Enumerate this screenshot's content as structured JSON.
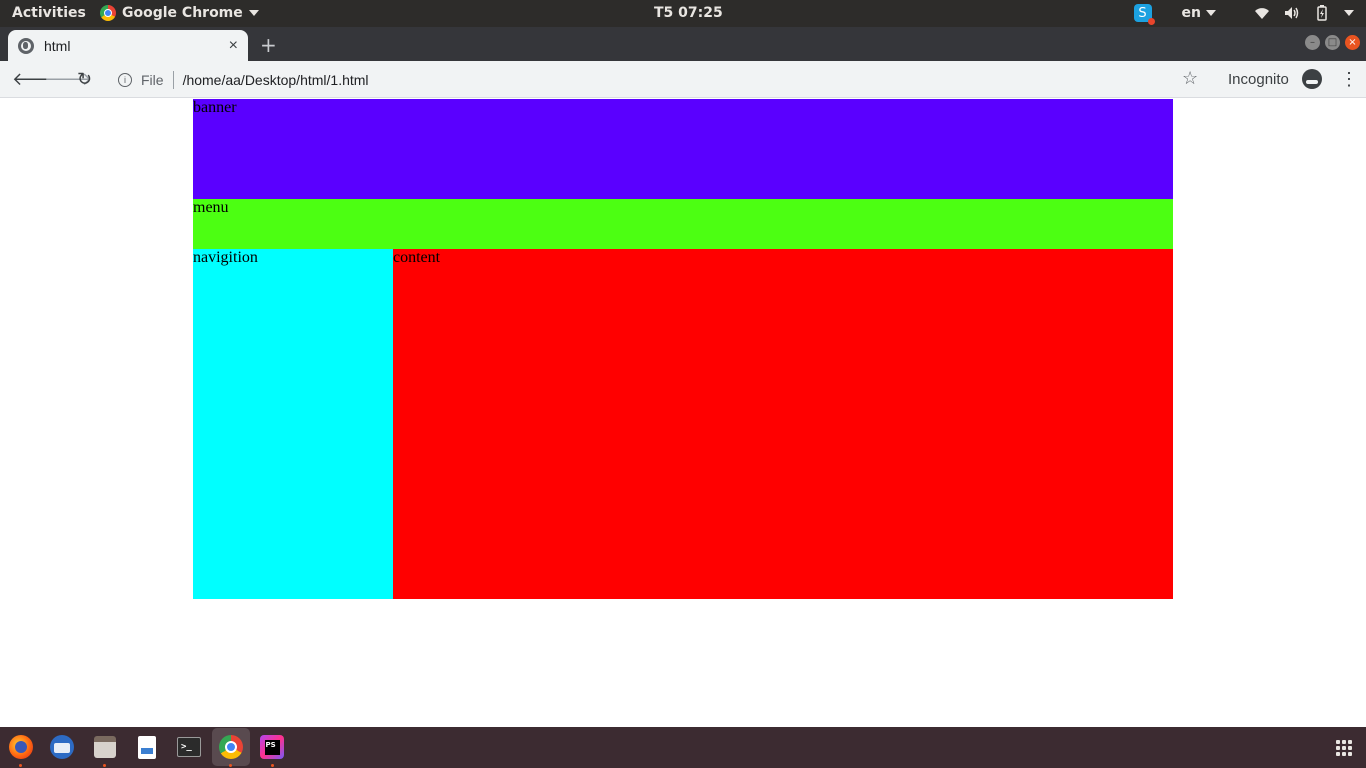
{
  "topbar": {
    "activities": "Activities",
    "app_name": "Google Chrome",
    "clock": "T5 07:25",
    "language": "en"
  },
  "browser": {
    "tab_title": "html",
    "tab_close": "×",
    "new_tab": "+",
    "file_label": "File",
    "url": "/home/aa/Desktop/html/1.html",
    "incognito_label": "Incognito"
  },
  "page": {
    "banner": {
      "text": "banner",
      "color": "#5a00ff"
    },
    "menu": {
      "text": "menu",
      "color": "#4cff12"
    },
    "navigation": {
      "text": "navigition",
      "color": "#00ffff"
    },
    "content": {
      "text": "content",
      "color": "#ff0000"
    }
  },
  "dock": {
    "items": [
      "firefox-icon",
      "thunderbird-icon",
      "files-icon",
      "text-editor-icon",
      "terminal-icon",
      "chrome-icon",
      "phpstorm-icon"
    ]
  }
}
